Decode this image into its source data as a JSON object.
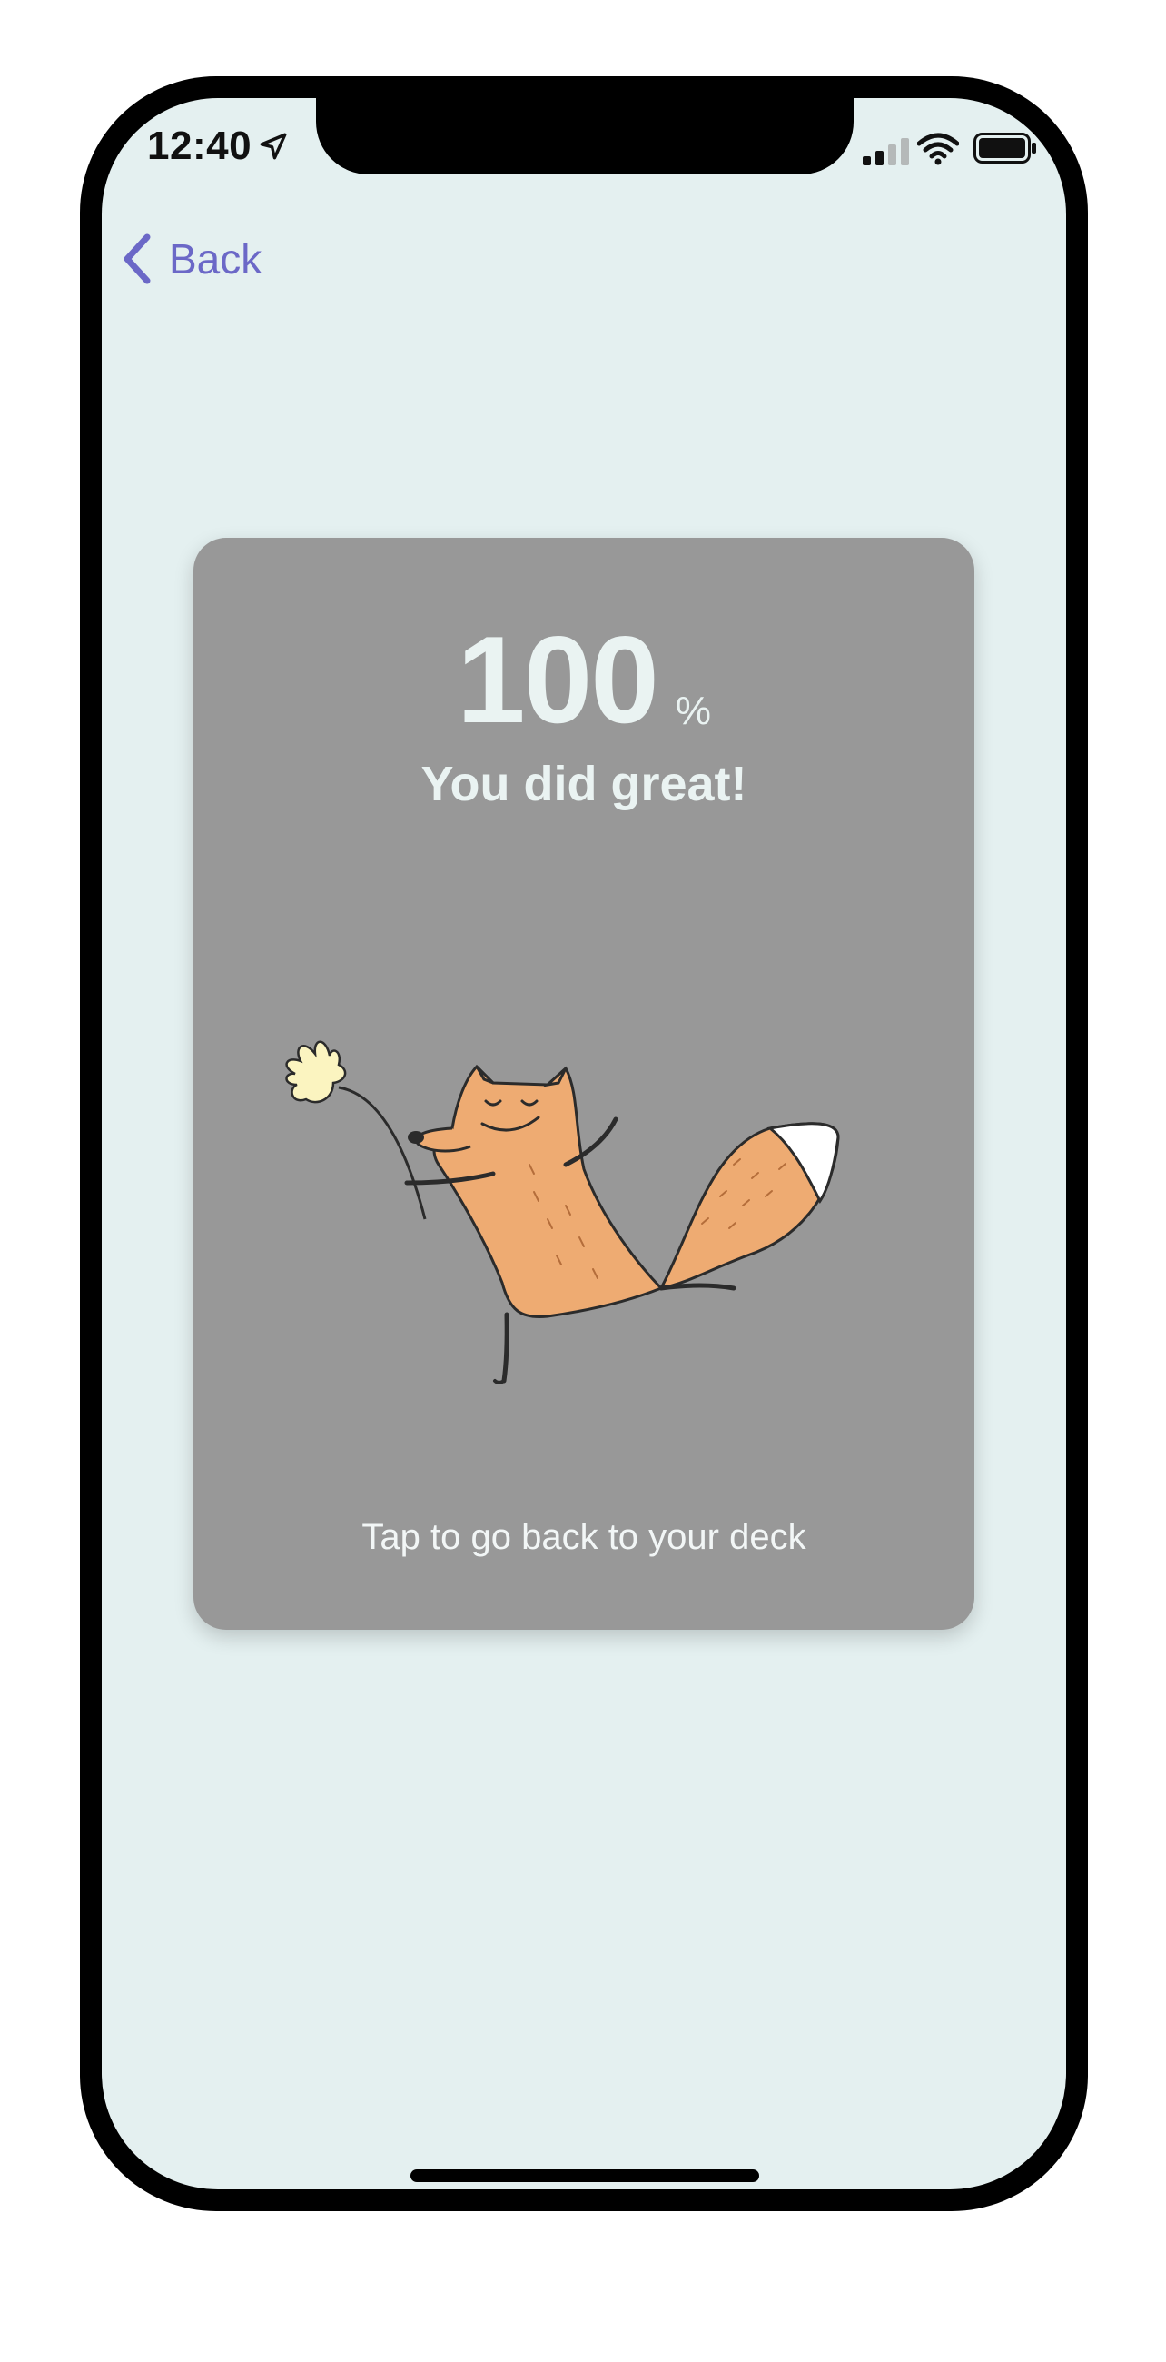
{
  "status_bar": {
    "time": "12:40",
    "location_icon": "location-arrow-icon",
    "signal_icon": "cellular-signal-icon",
    "wifi_icon": "wifi-icon",
    "battery_icon": "battery-icon"
  },
  "nav": {
    "back_label": "Back",
    "back_icon": "chevron-left-icon"
  },
  "result": {
    "score": "100",
    "unit": "%",
    "headline": "You did great!",
    "illustration": "dancing-fox-illustration",
    "hint": "Tap to go back to your deck"
  },
  "colors": {
    "screen_background": "#e4f0f0",
    "card_background": "#989898",
    "accent": "#6b68c7",
    "fox_orange": "#eeab72",
    "flower_yellow": "#fbf4c0"
  }
}
